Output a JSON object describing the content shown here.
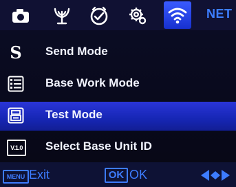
{
  "tabs": [
    {
      "icon": "camera-icon"
    },
    {
      "icon": "trigger-icon"
    },
    {
      "icon": "timer-icon"
    },
    {
      "icon": "settings-icon"
    },
    {
      "icon": "wifi-icon",
      "selected": true
    }
  ],
  "tab_label": "NET",
  "menu": {
    "items": [
      {
        "label": "Send Mode",
        "icon": "send-mode-icon",
        "icon_text": "S"
      },
      {
        "label": "Base Work Mode",
        "icon": "list-icon"
      },
      {
        "label": "Test Mode",
        "icon": "test-mode-icon",
        "selected": true
      },
      {
        "label": "Select Base Unit ID",
        "icon": "version-icon",
        "icon_text": "V.1.0"
      }
    ]
  },
  "footer": {
    "menu_key": "MENU",
    "exit_label": "Exit",
    "ok_key": "OK",
    "ok_label": "OK",
    "nav_icon": "left-right-arrows-icon"
  },
  "colors": {
    "accent": "#3d7cff",
    "selected_row": "#1f2ec6",
    "background": "#0b0d26"
  }
}
